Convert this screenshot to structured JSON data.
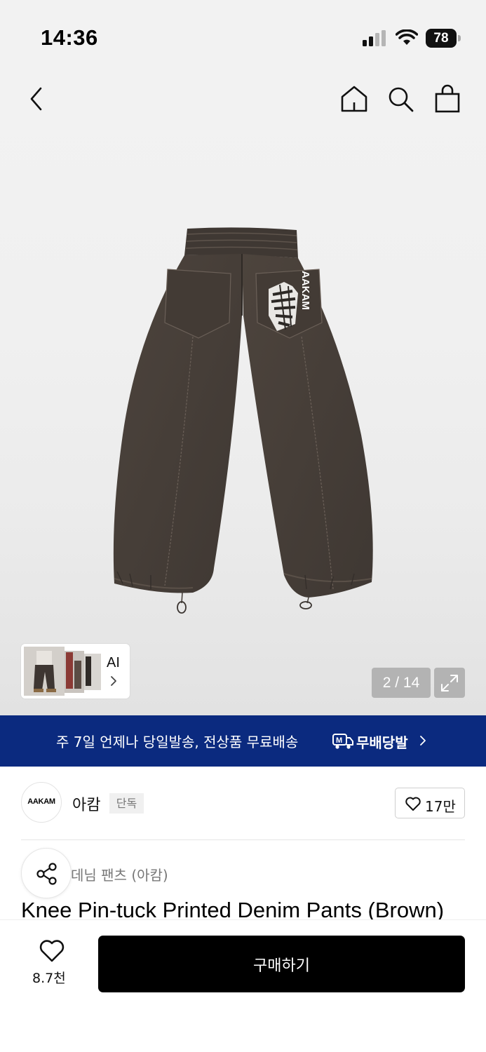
{
  "status_bar": {
    "time": "14:36",
    "battery": "78"
  },
  "nav": {
    "back_icon": "chevron-left",
    "home_icon": "home",
    "search_icon": "search",
    "bag_icon": "shopping-bag"
  },
  "gallery": {
    "pocket_print_text": "AAKAM",
    "ai_label": "AI",
    "page_counter": "2 / 14",
    "expand_icon": "expand-arrows"
  },
  "banner": {
    "text": "주 7일 언제나 당일발송, 전상품 무료배송",
    "brand": "무배당발",
    "logo_letter": "M",
    "background": "#0b2a7f"
  },
  "brand": {
    "logo_text": "AAKAM",
    "name": "아캄",
    "badge": "단독",
    "like_count": "17만"
  },
  "product": {
    "category": "데님 팬츠 (아캄)",
    "title": "Knee Pin-tuck Printed Denim Pants (Brown)",
    "image_color": "#4a423c"
  },
  "bottom_bar": {
    "wish_count": "8.7천",
    "buy_label": "구매하기"
  }
}
